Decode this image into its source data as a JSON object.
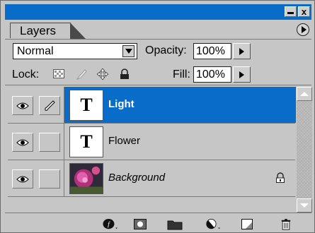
{
  "panel": {
    "tab_label": "Layers",
    "title_buttons": {
      "minimize": "minimize",
      "close": "x"
    },
    "accent_color": "#0a6cc9"
  },
  "blend_mode": {
    "value": "Normal",
    "options_visible": [
      "Normal"
    ]
  },
  "opacity": {
    "label": "Opacity:",
    "value": "100%"
  },
  "lock": {
    "label": "Lock:",
    "icons": [
      "lock-transparency-icon",
      "lock-image-pixels-icon",
      "lock-position-icon",
      "lock-all-icon"
    ]
  },
  "fill": {
    "label": "Fill:",
    "value": "100%"
  },
  "layers": [
    {
      "name": "Light",
      "type": "text",
      "thumb_glyph": "T",
      "visible": true,
      "selected": true,
      "locked": false,
      "italic": false
    },
    {
      "name": "Flower",
      "type": "text",
      "thumb_glyph": "T",
      "visible": true,
      "selected": false,
      "locked": false,
      "italic": false
    },
    {
      "name": "Background",
      "type": "image",
      "thumb_glyph": "",
      "visible": true,
      "selected": false,
      "locked": true,
      "italic": true
    }
  ],
  "bottom_toolbar": {
    "icons": [
      "layer-style-icon",
      "layer-mask-icon",
      "new-group-icon",
      "adjustment-layer-icon",
      "new-layer-icon",
      "delete-layer-icon"
    ]
  }
}
